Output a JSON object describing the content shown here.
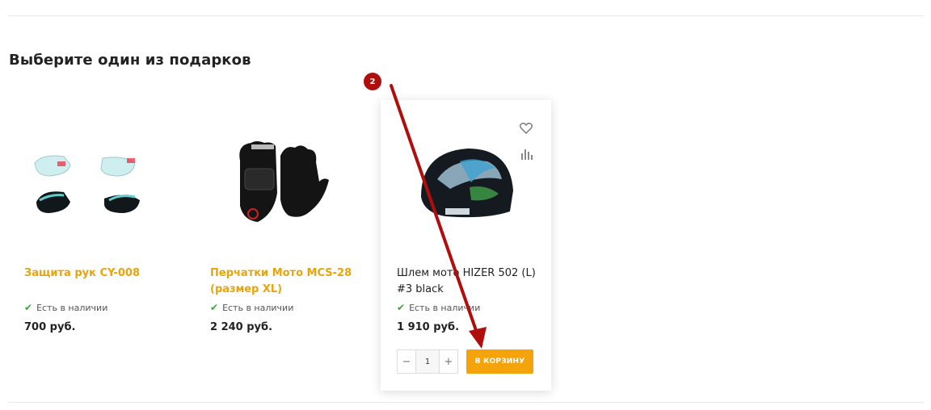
{
  "section": {
    "title": "Выберите один из подарков"
  },
  "products": [
    {
      "name": "Защита рук CY-008",
      "stock": "Есть в наличии",
      "price": "700 руб."
    },
    {
      "name": "Перчатки Мото MCS-28 (размер XL)",
      "stock": "Есть в наличии",
      "price": "2 240 руб."
    },
    {
      "name": "Шлем мото HIZER 502 (L) #3 black",
      "stock": "Есть в наличии",
      "price": "1 910 руб.",
      "quantity": {
        "minus": "−",
        "value": "1",
        "plus": "+"
      },
      "cart_label": "В КОРЗИНУ"
    }
  ],
  "annotation": {
    "step_number": "2"
  },
  "colors": {
    "accent": "#f5a30a",
    "product_link": "#e8a40c",
    "in_stock": "#3fa43f",
    "annotation": "#b00d0d"
  },
  "icons": [
    "heart-icon",
    "compare-chart-icon",
    "checkmark-icon"
  ]
}
